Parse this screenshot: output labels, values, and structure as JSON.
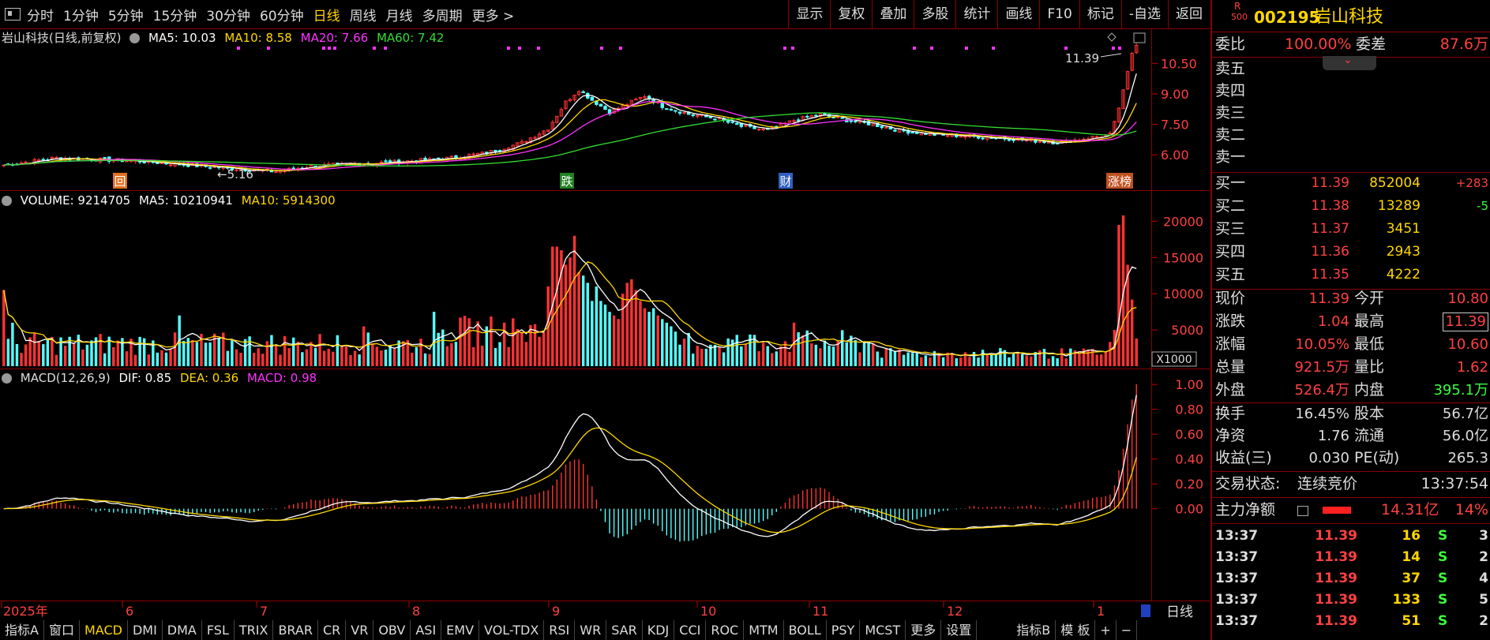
{
  "toolbar": {
    "tabs": [
      "分时",
      "1分钟",
      "5分钟",
      "15分钟",
      "30分钟",
      "60分钟",
      "日线",
      "周线",
      "月线",
      "多周期",
      "更多 >"
    ],
    "active_tab": "日线",
    "buttons": [
      "显示",
      "复权",
      "叠加",
      "多股",
      "统计",
      "画线",
      "F10",
      "标记",
      "-自选",
      "返回"
    ]
  },
  "price_panel": {
    "title": "岩山科技(日线,前复权)",
    "ma": [
      {
        "label": "MA5: 10.03",
        "color": "#ffffff"
      },
      {
        "label": "MA10: 8.58",
        "color": "#ffd700"
      },
      {
        "label": "MA20: 7.66",
        "color": "#ff33ff"
      },
      {
        "label": "MA60: 7.42",
        "color": "#33dd33"
      }
    ],
    "max_label": "11.39",
    "min_label": "←5.16",
    "markers": [
      "回",
      "跌",
      "财",
      "涨榜"
    ]
  },
  "volume_panel": {
    "legend": [
      {
        "label": "VOLUME: 9214705",
        "color": "#ffffff"
      },
      {
        "label": "MA5: 10210941",
        "color": "#ffffff"
      },
      {
        "label": "MA10: 5914300",
        "color": "#ffd700"
      }
    ],
    "unit": "X1000"
  },
  "macd_panel": {
    "legend": [
      {
        "label": "MACD(12,26,9)",
        "color": "#ffffff"
      },
      {
        "label": "DIF: 0.85",
        "color": "#ffffff"
      },
      {
        "label": "DEA: 0.36",
        "color": "#ffd700"
      },
      {
        "label": "MACD: 0.98",
        "color": "#ff33ff"
      }
    ]
  },
  "xaxis": {
    "labels": [
      "2025年",
      "6",
      "7",
      "8",
      "9",
      "10",
      "11",
      "12",
      "1"
    ],
    "period": "日线"
  },
  "bottom_tabs": [
    "指标A",
    "窗口",
    "MACD",
    "DMI",
    "DMA",
    "FSL",
    "TRIX",
    "BRAR",
    "CR",
    "VR",
    "OBV",
    "ASI",
    "EMV",
    "VOL-TDX",
    "RSI",
    "WR",
    "SAR",
    "KDJ",
    "CCI",
    "ROC",
    "MTM",
    "BOLL",
    "PSY",
    "MCST",
    "更多",
    "设置",
    "指标B",
    "模 板",
    "+",
    "−"
  ],
  "bottom_active": "MACD",
  "quote": {
    "rank": "R",
    "rank_sub": "500",
    "code": "002195",
    "name": "岩山科技",
    "weibi_label": "委比",
    "weibi": "100.00%",
    "weicha_label": "委差",
    "weicha": "87.6万",
    "sell": [
      {
        "label": "卖五"
      },
      {
        "label": "卖四"
      },
      {
        "label": "卖三"
      },
      {
        "label": "卖二"
      },
      {
        "label": "卖一"
      }
    ],
    "buy": [
      {
        "label": "买一",
        "price": "11.39",
        "vol": "852004",
        "chg": "+283"
      },
      {
        "label": "买二",
        "price": "11.38",
        "vol": "13289",
        "chg": "-5"
      },
      {
        "label": "买三",
        "price": "11.37",
        "vol": "3451",
        "chg": ""
      },
      {
        "label": "买四",
        "price": "11.36",
        "vol": "2943",
        "chg": ""
      },
      {
        "label": "买五",
        "price": "11.35",
        "vol": "4222",
        "chg": ""
      }
    ],
    "stats": [
      {
        "l1": "现价",
        "v1": "11.39",
        "l2": "今开",
        "v2": "10.80"
      },
      {
        "l1": "涨跌",
        "v1": "1.04",
        "l2": "最高",
        "v2": "11.39"
      },
      {
        "l1": "涨幅",
        "v1": "10.05%",
        "l2": "最低",
        "v2": "10.60"
      },
      {
        "l1": "总量",
        "v1": "921.5万",
        "l2": "量比",
        "v2": "1.62"
      },
      {
        "l1": "外盘",
        "v1": "526.4万",
        "l2": "内盘",
        "v2": "395.1万"
      }
    ],
    "stats2": [
      {
        "l1": "换手",
        "v1": "16.45%",
        "l2": "股本",
        "v2": "56.7亿"
      },
      {
        "l1": "净资",
        "v1": "1.76",
        "l2": "流通",
        "v2": "56.0亿"
      },
      {
        "l1": "收益(三)",
        "v1": "0.030",
        "l2": "PE(动)",
        "v2": "265.3"
      }
    ],
    "status_label": "交易状态:",
    "status": "连续竞价",
    "status_time": "13:37:54",
    "netflow_label": "主力净额",
    "netflow": "14.31亿",
    "netflow_pct": "14%",
    "ticks": [
      {
        "time": "13:37",
        "price": "11.39",
        "vol": "16",
        "side": "S",
        "n": "3"
      },
      {
        "time": "13:37",
        "price": "11.39",
        "vol": "14",
        "side": "S",
        "n": "2"
      },
      {
        "time": "13:37",
        "price": "11.39",
        "vol": "37",
        "side": "S",
        "n": "4"
      },
      {
        "time": "13:37",
        "price": "11.39",
        "vol": "133",
        "side": "S",
        "n": "5"
      },
      {
        "time": "13:37",
        "price": "11.39",
        "vol": "51",
        "side": "S",
        "n": "2"
      }
    ]
  },
  "chart_data": [
    {
      "type": "candlestick",
      "title": "岩山科技(日线,前复权)",
      "ylim": [
        5.0,
        11.6
      ],
      "yticks": [
        6.0,
        7.5,
        9.0,
        10.5
      ],
      "anchors": [
        {
          "i": 0,
          "p": 5.5
        },
        {
          "i": 12,
          "p": 5.85
        },
        {
          "i": 30,
          "p": 5.7
        },
        {
          "i": 42,
          "p": 5.5
        },
        {
          "i": 54,
          "p": 5.3
        },
        {
          "i": 62,
          "p": 5.18
        },
        {
          "i": 70,
          "p": 5.45
        },
        {
          "i": 85,
          "p": 5.6
        },
        {
          "i": 100,
          "p": 5.8
        },
        {
          "i": 110,
          "p": 6.1
        },
        {
          "i": 118,
          "p": 6.6
        },
        {
          "i": 124,
          "p": 7.3
        },
        {
          "i": 128,
          "p": 8.6
        },
        {
          "i": 131,
          "p": 9.2
        },
        {
          "i": 134,
          "p": 8.7
        },
        {
          "i": 138,
          "p": 8.1
        },
        {
          "i": 142,
          "p": 8.5
        },
        {
          "i": 146,
          "p": 8.9
        },
        {
          "i": 150,
          "p": 8.4
        },
        {
          "i": 156,
          "p": 8.0
        },
        {
          "i": 162,
          "p": 7.8
        },
        {
          "i": 168,
          "p": 7.4
        },
        {
          "i": 174,
          "p": 7.2
        },
        {
          "i": 180,
          "p": 7.7
        },
        {
          "i": 186,
          "p": 8.0
        },
        {
          "i": 192,
          "p": 7.7
        },
        {
          "i": 198,
          "p": 7.5
        },
        {
          "i": 204,
          "p": 7.2
        },
        {
          "i": 212,
          "p": 7.0
        },
        {
          "i": 222,
          "p": 6.9
        },
        {
          "i": 232,
          "p": 6.75
        },
        {
          "i": 240,
          "p": 6.6
        },
        {
          "i": 246,
          "p": 6.8
        },
        {
          "i": 252,
          "p": 7.0
        },
        {
          "i": 254,
          "p": 8.3
        },
        {
          "i": 255,
          "p": 9.2
        },
        {
          "i": 256,
          "p": 10.1
        },
        {
          "i": 257,
          "p": 11.0
        },
        {
          "i": 258,
          "p": 11.39
        }
      ],
      "ma_periods": [
        5,
        10,
        20,
        60
      ]
    },
    {
      "type": "bar",
      "title": "VOLUME",
      "ylim": [
        0,
        22000
      ],
      "yticks": [
        5000,
        10000,
        15000,
        20000
      ],
      "unit": "X1000",
      "spikes": [
        {
          "i": 124,
          "v": 11000
        },
        {
          "i": 125,
          "v": 16500
        },
        {
          "i": 126,
          "v": 16500
        },
        {
          "i": 127,
          "v": 16000
        },
        {
          "i": 128,
          "v": 14000
        },
        {
          "i": 129,
          "v": 15000
        },
        {
          "i": 130,
          "v": 18000
        },
        {
          "i": 131,
          "v": 13000
        },
        {
          "i": 132,
          "v": 12500
        },
        {
          "i": 133,
          "v": 11500
        },
        {
          "i": 134,
          "v": 9000
        },
        {
          "i": 135,
          "v": 11000
        },
        {
          "i": 136,
          "v": 9000
        },
        {
          "i": 137,
          "v": 8500
        },
        {
          "i": 138,
          "v": 7500
        },
        {
          "i": 139,
          "v": 7000
        },
        {
          "i": 140,
          "v": 6500
        },
        {
          "i": 141,
          "v": 10000
        },
        {
          "i": 142,
          "v": 11500
        },
        {
          "i": 143,
          "v": 12000
        },
        {
          "i": 144,
          "v": 10500
        },
        {
          "i": 145,
          "v": 9000
        },
        {
          "i": 146,
          "v": 8000
        },
        {
          "i": 147,
          "v": 7500
        },
        {
          "i": 148,
          "v": 8000
        },
        {
          "i": 149,
          "v": 7000
        },
        {
          "i": 150,
          "v": 6500
        },
        {
          "i": 151,
          "v": 6000
        },
        {
          "i": 152,
          "v": 5500
        },
        {
          "i": 98,
          "v": 7500
        },
        {
          "i": 82,
          "v": 5500
        },
        {
          "i": 40,
          "v": 7000
        },
        {
          "i": 0,
          "v": 10500
        },
        {
          "i": 2,
          "v": 6000
        },
        {
          "i": 180,
          "v": 6000
        },
        {
          "i": 253,
          "v": 5000
        },
        {
          "i": 254,
          "v": 19500
        },
        {
          "i": 255,
          "v": 20800
        },
        {
          "i": 256,
          "v": 14000
        },
        {
          "i": 257,
          "v": 9200
        }
      ]
    },
    {
      "type": "line",
      "title": "MACD(12,26,9)",
      "ylim": [
        -0.72,
        1.02
      ],
      "yticks": [
        0.0,
        0.2,
        0.4,
        0.6,
        0.8,
        1.0
      ],
      "series": [
        {
          "name": "DIF",
          "color": "#ffffff"
        },
        {
          "name": "DEA",
          "color": "#ffd700"
        },
        {
          "name": "MACD",
          "color": "#ff33ff"
        }
      ]
    }
  ]
}
